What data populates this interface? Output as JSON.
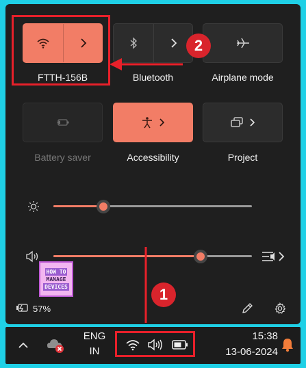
{
  "quick_settings": {
    "wifi": {
      "label": "FTTH-156B",
      "state": "on"
    },
    "bluetooth": {
      "label": "Bluetooth",
      "state": "off"
    },
    "airplane": {
      "label": "Airplane mode",
      "state": "off"
    },
    "battery_saver": {
      "label": "Battery saver",
      "state": "disabled"
    },
    "accessibility": {
      "label": "Accessibility",
      "state": "on"
    },
    "project": {
      "label": "Project"
    }
  },
  "sliders": {
    "brightness": {
      "value": 0.25
    },
    "volume": {
      "value": 0.74
    }
  },
  "footer": {
    "battery_percent": "57%"
  },
  "taskbar": {
    "language_line1": "ENG",
    "language_line2": "IN",
    "time": "15:38",
    "date": "13-06-2024"
  },
  "annotations": {
    "step1": "1",
    "step2": "2",
    "color": "#e8202a"
  },
  "watermark": {
    "line1": "HOW TO",
    "line2": "MANAGE",
    "line3": "DEVICES"
  },
  "colors": {
    "accent": "#f27d66",
    "panel": "#1f1f1f",
    "border": "#1fd0e6"
  },
  "icons": [
    "wifi-icon",
    "bluetooth-icon",
    "airplane-icon",
    "battery-saver-icon",
    "accessibility-icon",
    "project-icon",
    "brightness-icon",
    "volume-icon",
    "audio-output-icon",
    "battery-icon",
    "edit-icon",
    "settings-icon",
    "chevron-up-icon",
    "onedrive-error-icon",
    "notification-bell-icon"
  ]
}
